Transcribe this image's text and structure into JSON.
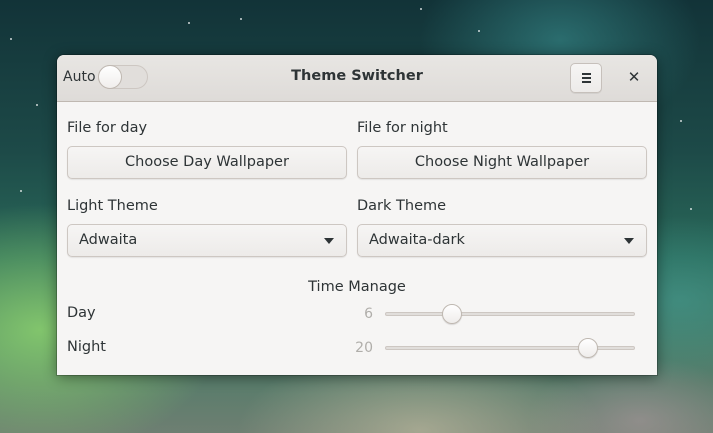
{
  "window": {
    "title": "Theme Switcher",
    "auto_label": "Auto",
    "auto_enabled": false,
    "menu_icon": "hamburger-menu-icon",
    "close_icon": "close-icon",
    "close_glyph": "✕"
  },
  "wallpaper": {
    "day_label": "File for day",
    "night_label": "File for night",
    "day_button": "Choose Day Wallpaper",
    "night_button": "Choose Night Wallpaper"
  },
  "themes": {
    "light_label": "Light Theme",
    "dark_label": "Dark Theme",
    "light_value": "Adwaita",
    "dark_value": "Adwaita-dark"
  },
  "time": {
    "section_title": "Time Manage",
    "day_label": "Day",
    "night_label": "Night",
    "day_value": "6",
    "night_value": "20",
    "scale_range": [
      0,
      24
    ]
  }
}
